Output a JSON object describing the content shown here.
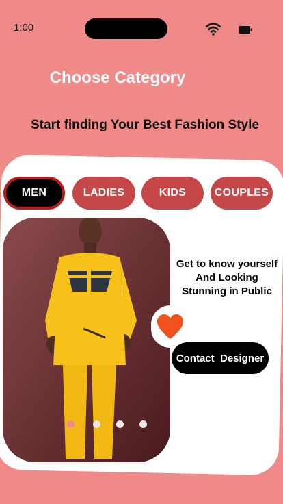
{
  "status_bar": {
    "time": "1:00",
    "wifi_icon": "wifi-icon",
    "battery_icon": "battery-icon"
  },
  "header": {
    "title": "Choose Category",
    "subtitle": "Start finding Your Best Fashion Style"
  },
  "tabs": [
    {
      "label": "MEN",
      "active": true
    },
    {
      "label": "LADIES",
      "active": false
    },
    {
      "label": "KIDS",
      "active": false
    },
    {
      "label": "COUPLES",
      "active": false
    }
  ],
  "carousel": {
    "slide_count": 4,
    "current_slide": 1
  },
  "promo": {
    "line1": "Get to know yourself",
    "line2": "And Looking",
    "line3": "Stunning in Public"
  },
  "favorite_icon": "heart-icon",
  "contact_button": {
    "label": "Contact  Designer"
  },
  "colors": {
    "background": "#ef8a88",
    "tab_inactive": "#c64747",
    "tab_active_border": "#b71f1f",
    "heart": "#f0521e",
    "outfit": "#f6c21a"
  }
}
